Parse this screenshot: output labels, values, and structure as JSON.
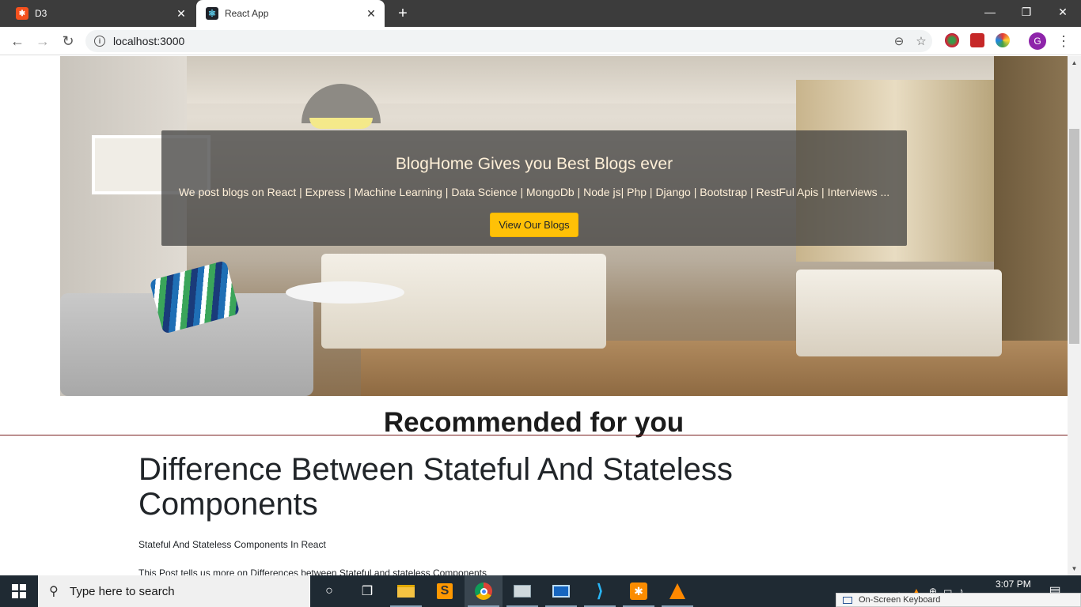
{
  "browser": {
    "tabs": [
      {
        "title": "D3",
        "favicon_color": "#f4511e",
        "favicon_glyph": "X"
      },
      {
        "title": "React App",
        "favicon_color": "#20232a",
        "favicon_glyph": "⚛"
      }
    ],
    "new_tab_glyph": "+",
    "url": "localhost:3000",
    "avatar_letter": "G"
  },
  "hero": {
    "title": "BlogHome Gives you Best Blogs ever",
    "subtitle": "We post blogs on React | Express | Machine Learning | Data Science | MongoDb | Node js| Php | Django | Bootstrap | RestFul Apis | Interviews ...",
    "cta_label": "View Our Blogs",
    "cta_color": "#ffc107"
  },
  "recommended": {
    "heading": "Recommended for you",
    "line_color": "#7a1f1f"
  },
  "post": {
    "title": "Difference Between Stateful And Stateless Components",
    "subtitle": "Stateful And Stateless Components In React",
    "description": "This Post tells us more on Differences between Stateful and stateless Components"
  },
  "taskbar": {
    "search_placeholder": "Type here to search",
    "clock": "3:07 PM",
    "osk_label": "On-Screen Keyboard",
    "apps": [
      "cortana-icon",
      "task-view-icon",
      "file-explorer-icon",
      "sublime-icon",
      "chrome-icon",
      "photos-icon",
      "remote-desktop-icon",
      "vscode-icon",
      "xampp-icon",
      "vlc-icon"
    ]
  }
}
